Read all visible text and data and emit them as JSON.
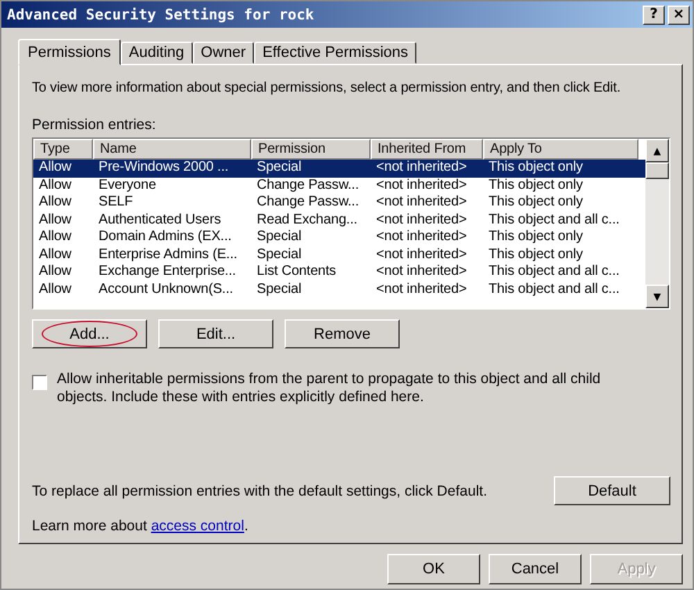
{
  "window": {
    "title": "Advanced Security Settings for rock",
    "title_buttons": [
      "?",
      "×"
    ]
  },
  "tabs": [
    {
      "label": "Permissions",
      "selected": true
    },
    {
      "label": "Auditing",
      "selected": false
    },
    {
      "label": "Owner",
      "selected": false
    },
    {
      "label": "Effective Permissions",
      "selected": false
    }
  ],
  "intro": "To view more information about special permissions, select a permission entry, and then click Edit.",
  "list_label": "Permission entries:",
  "table": {
    "columns": [
      "Type",
      "Name",
      "Permission",
      "Inherited From",
      "Apply To"
    ],
    "rows": [
      {
        "cells": [
          "Allow",
          "Pre-Windows 2000 ...",
          "Special",
          "<not inherited>",
          "This object only"
        ],
        "selected": true
      },
      {
        "cells": [
          "Allow",
          "Everyone",
          "Change Passw...",
          "<not inherited>",
          "This object only"
        ],
        "selected": false
      },
      {
        "cells": [
          "Allow",
          "SELF",
          "Change Passw...",
          "<not inherited>",
          "This object only"
        ],
        "selected": false
      },
      {
        "cells": [
          "Allow",
          "Authenticated Users",
          "Read Exchang...",
          "<not inherited>",
          "This object and all c..."
        ],
        "selected": false
      },
      {
        "cells": [
          "Allow",
          "Domain Admins (EX...",
          "Special",
          "<not inherited>",
          "This object only"
        ],
        "selected": false
      },
      {
        "cells": [
          "Allow",
          "Enterprise Admins (E...",
          "Special",
          "<not inherited>",
          "This object only"
        ],
        "selected": false
      },
      {
        "cells": [
          "Allow",
          "Exchange Enterprise...",
          "List Contents",
          "<not inherited>",
          "This object and all c..."
        ],
        "selected": false
      },
      {
        "cells": [
          "Allow",
          "Account Unknown(S...",
          "Special",
          "<not inherited>",
          "This object and all c..."
        ],
        "selected": false
      }
    ],
    "scroll_buttons": [
      "▲",
      "▼"
    ]
  },
  "entry_buttons": [
    {
      "label": "Add...",
      "circled": true
    },
    {
      "label": "Edit...",
      "circled": false
    },
    {
      "label": "Remove",
      "circled": false
    }
  ],
  "inherit_checkbox": {
    "label": "Allow inheritable permissions from the parent to propagate to this object and all child objects. Include these with entries explicitly defined here.",
    "checked": false
  },
  "default_text": "To replace all permission entries with the default settings, click Default.",
  "default_button": "Default",
  "learn_more": {
    "text": "Learn more about ",
    "link": "access control",
    "after": "."
  },
  "dialog_buttons": [
    {
      "label": "OK",
      "disabled": false
    },
    {
      "label": "Cancel",
      "disabled": false
    },
    {
      "label": "Apply",
      "disabled": true
    }
  ]
}
